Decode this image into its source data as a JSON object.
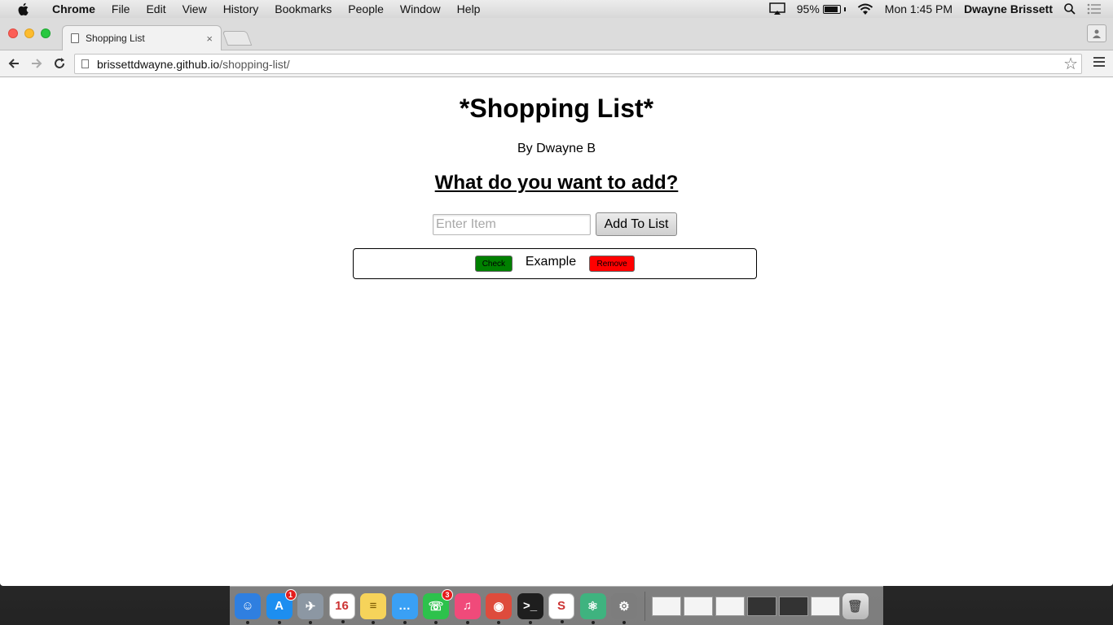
{
  "menubar": {
    "app_name": "Chrome",
    "items": [
      "File",
      "Edit",
      "View",
      "History",
      "Bookmarks",
      "People",
      "Window",
      "Help"
    ],
    "battery_percent": "95%",
    "battery_level": 0.95,
    "clock": "Mon 1:45 PM",
    "user_name": "Dwayne Brissett"
  },
  "browser": {
    "tab_title": "Shopping List",
    "tab_close": "×",
    "url_host": "brissettdwayne.github.io",
    "url_path": "/shopping-list/"
  },
  "page": {
    "title": "*Shopping List*",
    "subtitle": "By Dwayne B",
    "prompt": "What do you want to add?",
    "input_placeholder": "Enter Item",
    "add_button": "Add To List",
    "items": [
      {
        "check_label": "Check",
        "name": "Example",
        "remove_label": "Remove"
      }
    ]
  },
  "dock": {
    "apps": [
      {
        "name": "finder",
        "color": "#2f7fe0",
        "glyph": "☺"
      },
      {
        "name": "app-store",
        "color": "#1d8ef0",
        "glyph": "A",
        "badge": "1"
      },
      {
        "name": "launchpad",
        "color": "#8c97a3",
        "glyph": "✈"
      },
      {
        "name": "calendar",
        "color": "#ffffff",
        "glyph": "16"
      },
      {
        "name": "notes",
        "color": "#f6d35a",
        "glyph": "≡"
      },
      {
        "name": "messages",
        "color": "#3aa0f5",
        "glyph": "…"
      },
      {
        "name": "facetime",
        "color": "#2dc24c",
        "glyph": "☏",
        "badge": "3"
      },
      {
        "name": "itunes",
        "color": "#f04a7a",
        "glyph": "♫"
      },
      {
        "name": "chrome",
        "color": "#de4b3c",
        "glyph": "◉"
      },
      {
        "name": "terminal",
        "color": "#1e1e1e",
        "glyph": ">_"
      },
      {
        "name": "slack",
        "color": "#ffffff",
        "glyph": "S"
      },
      {
        "name": "atom",
        "color": "#3fb37f",
        "glyph": "⚛"
      },
      {
        "name": "system-preferences",
        "color": "#7d7d7d",
        "glyph": "⚙"
      }
    ],
    "minimized": [
      "light",
      "light",
      "light",
      "dark",
      "dark",
      "light"
    ]
  }
}
